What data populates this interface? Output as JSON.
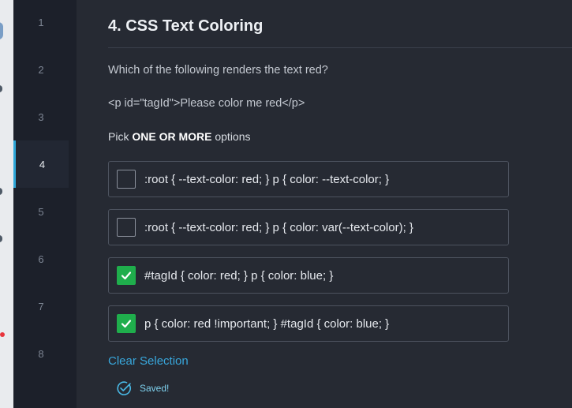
{
  "nav": {
    "items": [
      {
        "label": "1",
        "active": false
      },
      {
        "label": "2",
        "active": false
      },
      {
        "label": "3",
        "active": false
      },
      {
        "label": "4",
        "active": true
      },
      {
        "label": "5",
        "active": false
      },
      {
        "label": "6",
        "active": false
      },
      {
        "label": "7",
        "active": false
      },
      {
        "label": "8",
        "active": false
      }
    ]
  },
  "question": {
    "title": "4. CSS Text Coloring",
    "prompt": "Which of the following renders the text red?",
    "snippet": "<p id=\"tagId\">Please color me red</p>",
    "instruction_prefix": "Pick ",
    "instruction_emphasis": "ONE OR MORE",
    "instruction_suffix": " options",
    "options": [
      {
        "label": ":root { --text-color: red; } p { color: --text-color; }",
        "checked": false
      },
      {
        "label": ":root { --text-color: red; } p { color: var(--text-color); }",
        "checked": false
      },
      {
        "label": "#tagId { color: red; } p { color: blue; }",
        "checked": true
      },
      {
        "label": "p { color: red !important; } #tagId { color: blue; }",
        "checked": true
      }
    ],
    "clear_label": "Clear Selection",
    "saved_label": "Saved!"
  },
  "icons": {
    "check": "check-icon",
    "saved": "check-circle-icon"
  },
  "colors": {
    "accent": "#38a7dc",
    "checked": "#1fae4c",
    "active_indicator": "#2ea7d8"
  }
}
